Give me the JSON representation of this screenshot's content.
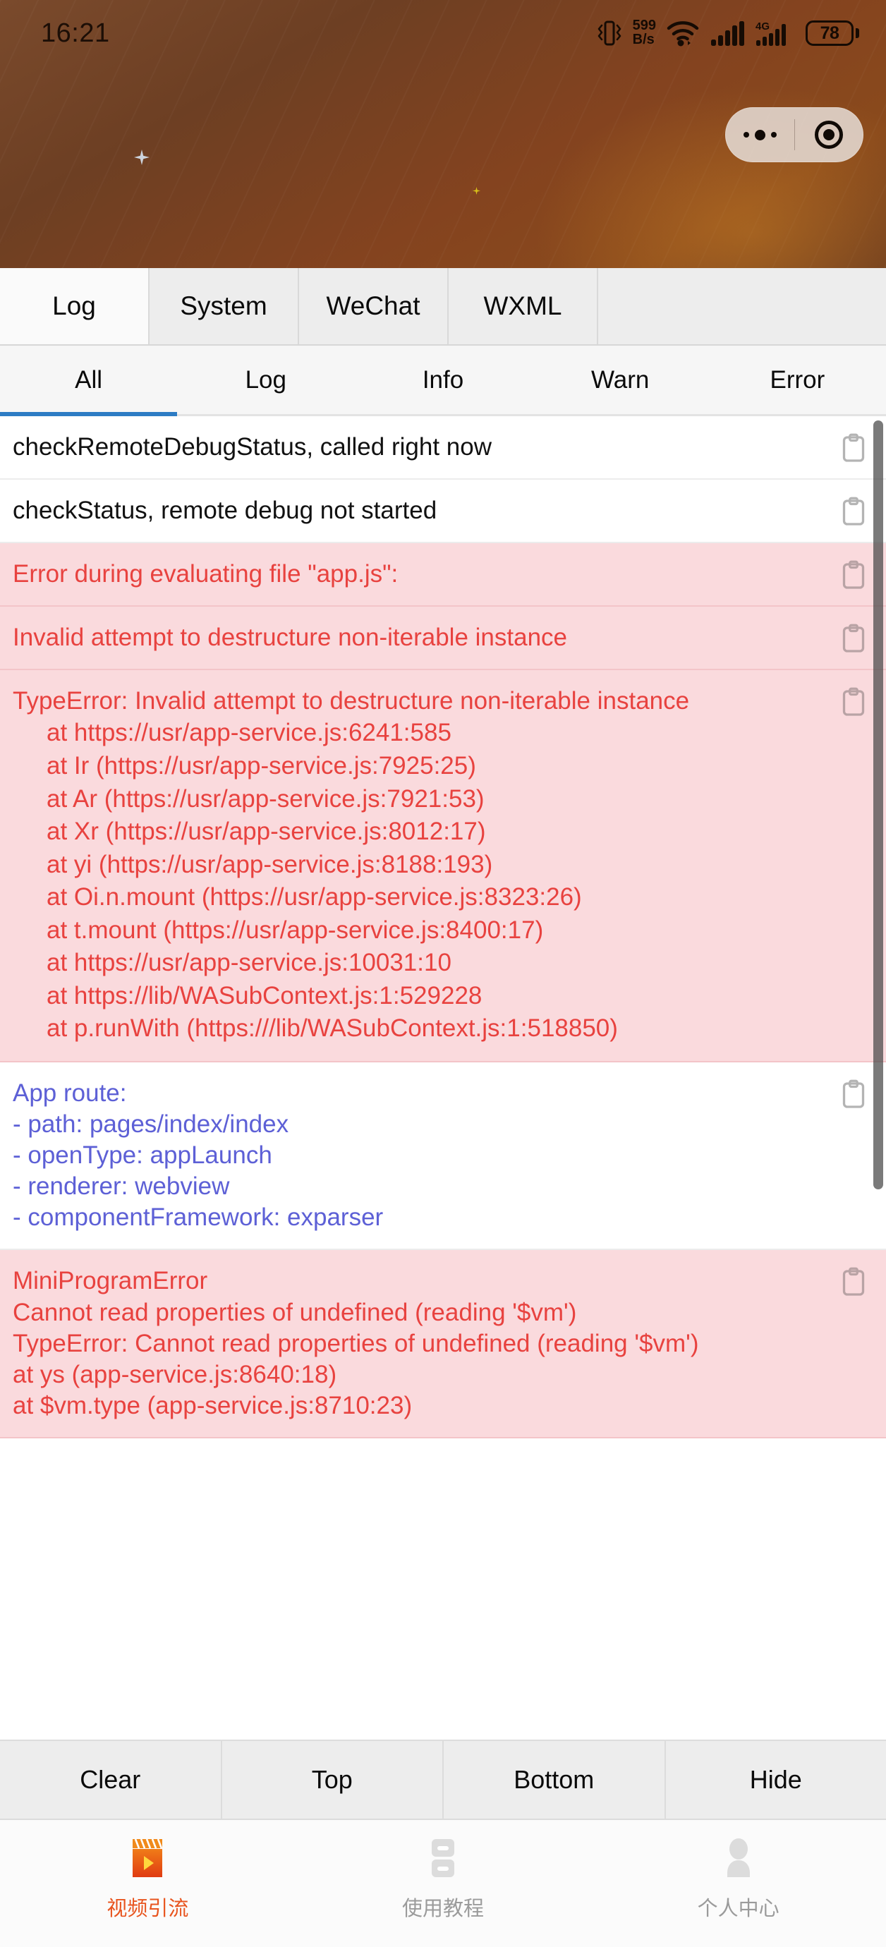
{
  "statusbar": {
    "time": "16:21",
    "netspeed_value": "599",
    "netspeed_unit": "B/s",
    "battery_level": "78",
    "icons": [
      "vibrate-icon",
      "wifi-icon",
      "signal-icon",
      "4g-signal-icon",
      "battery-icon"
    ],
    "signal_4g_label": "4G"
  },
  "capsule": {
    "more_label": "more-dots",
    "close_label": "target-circle"
  },
  "console": {
    "main_tabs": [
      {
        "label": "Log",
        "active": true
      },
      {
        "label": "System",
        "active": false
      },
      {
        "label": "WeChat",
        "active": false
      },
      {
        "label": "WXML",
        "active": false
      }
    ],
    "filter_tabs": [
      {
        "label": "All",
        "active": true
      },
      {
        "label": "Log",
        "active": false
      },
      {
        "label": "Info",
        "active": false
      },
      {
        "label": "Warn",
        "active": false
      },
      {
        "label": "Error",
        "active": false
      }
    ],
    "accent_color": "#2d7cc4",
    "error_bg": "#fadadd",
    "error_fg": "#e8423f",
    "route_fg": "#5d60d6",
    "rows": [
      {
        "kind": "log",
        "text": "checkRemoteDebugStatus, called right now",
        "sub": ""
      },
      {
        "kind": "log",
        "text": "checkStatus, remote debug not started",
        "sub": ""
      },
      {
        "kind": "error",
        "text": "Error during evaluating file \"app.js\":",
        "sub": ""
      },
      {
        "kind": "error",
        "text": "Invalid attempt to destructure non-iterable instance",
        "sub": ""
      },
      {
        "kind": "error",
        "text": "TypeError: Invalid attempt to destructure non-iterable instance",
        "sub": "at https://usr/app-service.js:6241:585\nat Ir (https://usr/app-service.js:7925:25)\nat Ar (https://usr/app-service.js:7921:53)\nat Xr (https://usr/app-service.js:8012:17)\nat yi (https://usr/app-service.js:8188:193)\nat Oi.n.mount (https://usr/app-service.js:8323:26)\nat t.mount (https://usr/app-service.js:8400:17)\nat https://usr/app-service.js:10031:10\nat https://lib/WASubContext.js:1:529228\nat p.runWith (https:///lib/WASubContext.js:1:518850)"
      },
      {
        "kind": "route",
        "text": "App route:\n- path: pages/index/index\n- openType: appLaunch\n- renderer: webview\n- componentFramework: exparser",
        "sub": ""
      },
      {
        "kind": "error",
        "text": "MiniProgramError\nCannot read properties of undefined (reading '$vm')\nTypeError: Cannot read properties of undefined (reading '$vm')\nat ys (app-service.js:8640:18)\nat $vm.type (app-service.js:8710:23)",
        "sub": ""
      }
    ],
    "copy_icon": "clipboard-copy-icon",
    "scrollbar": "vertical-scrollbar"
  },
  "action_bar": {
    "buttons": [
      "Clear",
      "Top",
      "Bottom",
      "Hide"
    ]
  },
  "tabbar": {
    "items": [
      {
        "label": "视频引流",
        "icon": "video-film-icon",
        "active": true
      },
      {
        "label": "使用教程",
        "icon": "document-lines-icon",
        "active": false
      },
      {
        "label": "个人中心",
        "icon": "person-icon",
        "active": false
      }
    ],
    "active_color": "#e8551f",
    "inactive_color": "#9b9b9b"
  }
}
